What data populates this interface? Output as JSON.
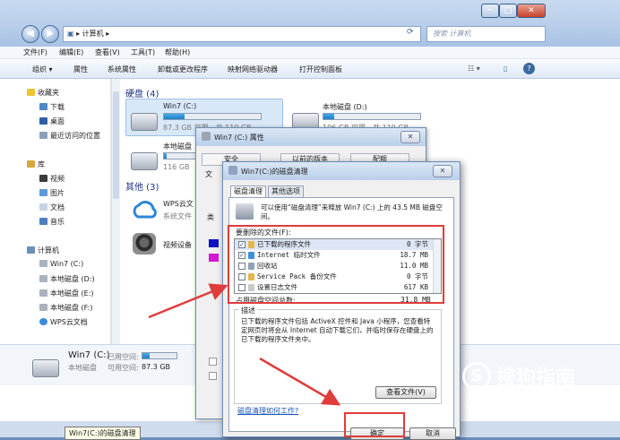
{
  "window": {
    "address_crumb": "计算机",
    "search_placeholder": "搜索 计算机",
    "controls": [
      "─",
      "□",
      "✕"
    ]
  },
  "menu": [
    "文件(F)",
    "编辑(E)",
    "查看(V)",
    "工具(T)",
    "帮助(H)"
  ],
  "toolbar": [
    "组织 ▾",
    "属性",
    "系统属性",
    "卸载或更改程序",
    "映射网络驱动器",
    "打开控制面板"
  ],
  "sidebar": {
    "favorites": "收藏夹",
    "fav_items": [
      "下载",
      "桌面",
      "最近访问的位置"
    ],
    "libraries": "库",
    "lib_items": [
      "视频",
      "图片",
      "文档",
      "音乐"
    ],
    "computer": "计算机",
    "computer_items": [
      "Win7 (C:)",
      "本地磁盘 (D:)",
      "本地磁盘 (E:)",
      "本地磁盘 (F:)",
      "WPS云文档"
    ]
  },
  "content": {
    "hdd_header": "硬盘 (4)",
    "drives": [
      {
        "name": "Win7 (C:)",
        "free": "87.3 GB 可用，共 110 GB",
        "usage": 0.21
      },
      {
        "name": "本地磁盘 (D:)",
        "free": "106 GB 可用，共 119 GB",
        "usage": 0.11
      },
      {
        "name": "本地磁盘",
        "free": "116 GB",
        "usage": 0.08
      }
    ],
    "other_header": "其他 (3)",
    "others": [
      {
        "name": "WPS云文",
        "sub": "系统文件"
      },
      {
        "name": "视频设备",
        "sub": ""
      }
    ]
  },
  "status": {
    "name": "Win7 (C:)",
    "used_label": "已用空间:",
    "type": "本地磁盘",
    "free_label": "可用空间:",
    "free_value": "87.3 GB",
    "usage": 0.21
  },
  "tooltip": "Win7(C:)的磁盘清理",
  "props_dialog": {
    "title": "Win7 (C:) 属性",
    "tabs": [
      "安全",
      "以前的版本",
      "配额"
    ],
    "fragments": [
      "类",
      "文"
    ]
  },
  "cleanup_dialog": {
    "title": "Win7(C:)的磁盘清理",
    "tabs": [
      "磁盘清理",
      "其他选项"
    ],
    "intro": "可以使用“磁盘清理”来释放 Win7 (C:) 上的 43.5 MB 磁盘空间。",
    "list_label": "要删除的文件(F):",
    "files": [
      {
        "name": "已下载的程序文件",
        "size": "0 字节",
        "checked": true,
        "color": "#e2b84a"
      },
      {
        "name": "Internet 临时文件",
        "size": "18.7 MB",
        "checked": true,
        "color": "#3f8fd8"
      },
      {
        "name": "回收站",
        "size": "11.0 MB",
        "checked": false,
        "color": "#8ca3b8"
      },
      {
        "name": "Service Pack 备份文件",
        "size": "0 字节",
        "checked": false,
        "color": "#e2b84a"
      },
      {
        "name": "设置日志文件",
        "size": "617 KB",
        "checked": false,
        "color": "#c9c9c9"
      }
    ],
    "total_label": "占用磁盘空间总数:",
    "total_value": "31.8 MB",
    "desc_label": "描述",
    "desc_text": "已下载的程序文件包括 ActiveX 控件和 Java 小程序，您查看特定网页时将会从 Internet 自动下载它们，并临时保存在硬盘上的已下载的程序文件夹中。",
    "view_files": "查看文件(V)",
    "link": "磁盘清理如何工作?",
    "ok": "确定",
    "cancel": "取消"
  },
  "watermark": {
    "brand": "搜狗指南",
    "url": "zhinan.sogou.com"
  }
}
